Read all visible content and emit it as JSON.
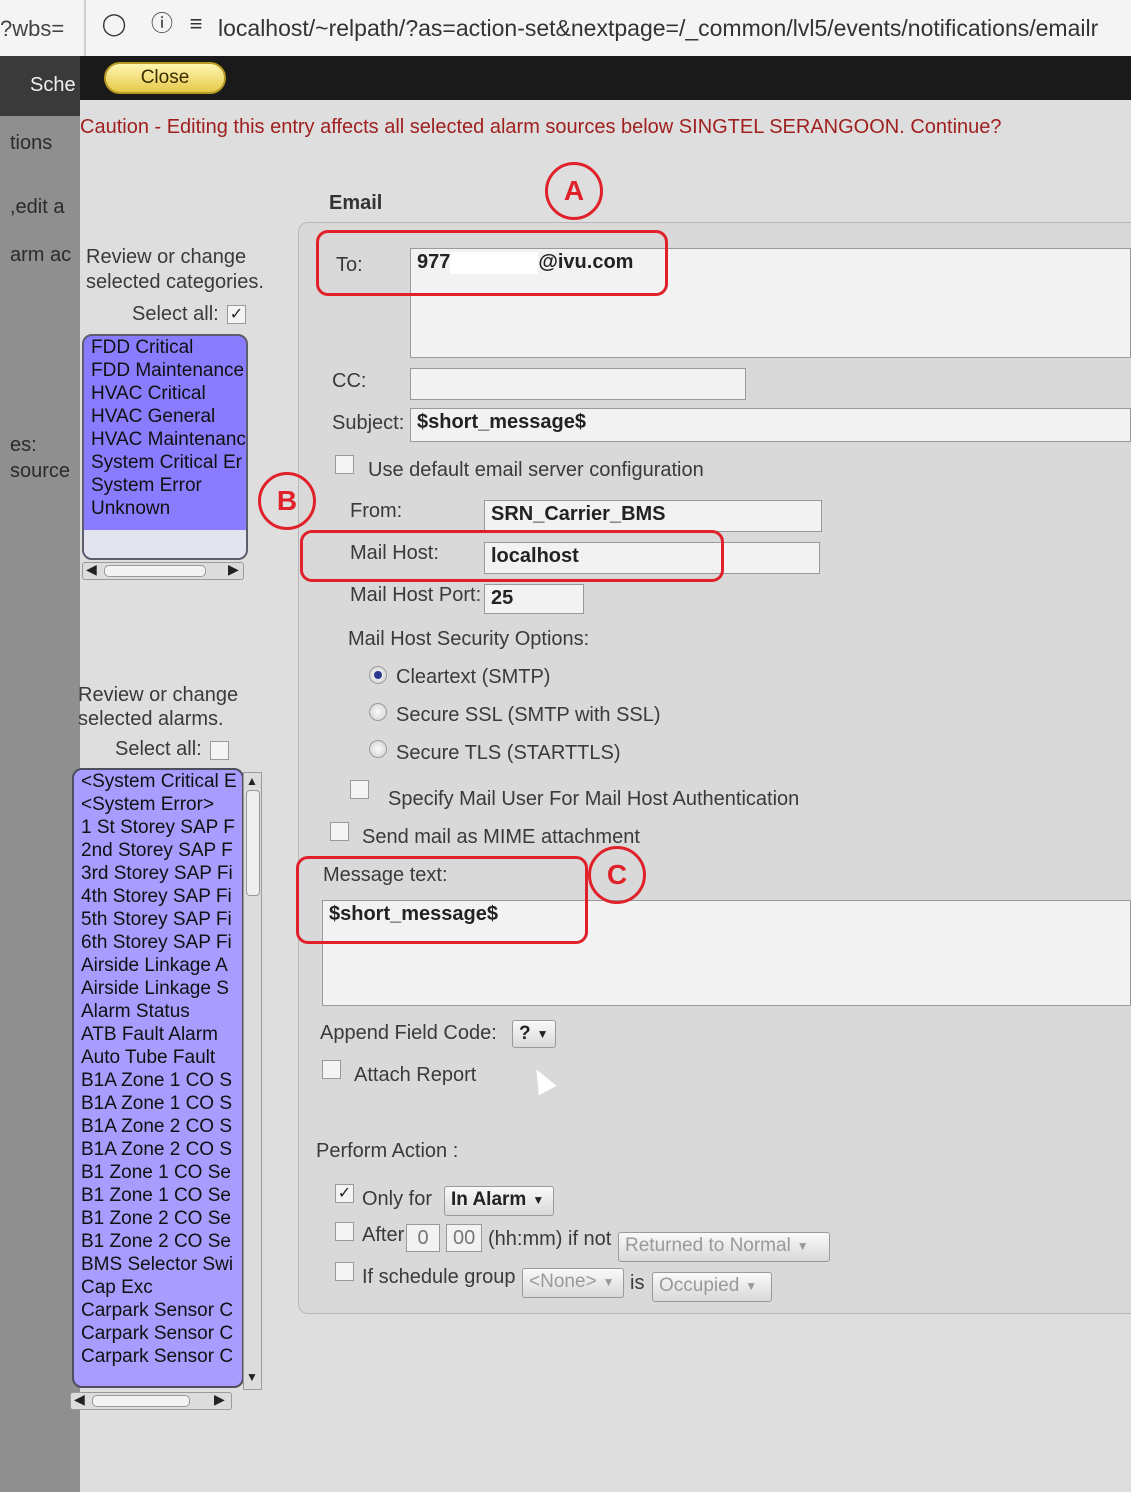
{
  "browser": {
    "left_fragment": "?wbs=",
    "url": "localhost/~relpath/?as=action-set&nextpage=/_common/lvl5/events/notifications/emailr"
  },
  "sidebar": {
    "sched": "Sche",
    "options": "tions",
    "edit": ",edit a",
    "alarm": "arm ac",
    "es": "es:",
    "source": "source"
  },
  "close_label": "Close",
  "caution": "Caution - Editing this entry affects all selected alarm sources below SINGTEL SERANGOON. Continue?",
  "categories": {
    "title_line1": "Review or change",
    "title_line2": "selected categories.",
    "select_all_label": "Select all:",
    "select_all_checked": true,
    "items": [
      "FDD Critical",
      "FDD Maintenance",
      "HVAC Critical",
      "HVAC General",
      "HVAC Maintenance",
      "System Critical Er",
      "System Error",
      "Unknown"
    ]
  },
  "alarms": {
    "title_line1": "Review or change",
    "title_line2": "selected alarms.",
    "select_all_label": "Select all:",
    "select_all_checked": false,
    "items": [
      "<System Critical E",
      "<System Error>",
      "1 St Storey SAP F",
      "2nd Storey SAP F",
      "3rd Storey SAP Fi",
      "4th Storey SAP Fi",
      "5th Storey SAP Fi",
      "6th Storey SAP Fi",
      "Airside Linkage A",
      "Airside Linkage S",
      "Alarm Status",
      "ATB Fault Alarm",
      "Auto Tube Fault",
      "B1A Zone 1 CO S",
      "B1A Zone 1 CO S",
      "B1A Zone 2 CO S",
      "B1A Zone 2 CO S",
      "B1 Zone 1 CO Se",
      "B1 Zone 1 CO Se",
      "B1 Zone 2 CO Se",
      "B1 Zone 2 CO Se",
      "BMS Selector Swi",
      "Cap Exc",
      "Carpark Sensor C",
      "Carpark Sensor C",
      "Carpark Sensor C"
    ]
  },
  "email": {
    "section_title": "Email",
    "to_label": "To:",
    "to_value": "977",
    "to_domain": "@ivu.com",
    "cc_label": "CC:",
    "cc_value": "",
    "subject_label": "Subject:",
    "subject_value": "$short_message$",
    "use_default_label": "Use default email server configuration",
    "use_default_checked": false,
    "from_label": "From:",
    "from_value": "SRN_Carrier_BMS",
    "mail_host_label": "Mail Host:",
    "mail_host_value": "localhost",
    "port_label": "Mail Host Port:",
    "port_value": "25",
    "security_label": "Mail Host Security Options:",
    "security_options": [
      {
        "label": "Cleartext (SMTP)",
        "selected": true
      },
      {
        "label": "Secure SSL (SMTP with SSL)",
        "selected": false
      },
      {
        "label": "Secure TLS (STARTTLS)",
        "selected": false
      }
    ],
    "specify_user_label": "Specify Mail User For Mail Host Authentication",
    "mime_label": "Send mail as MIME attachment",
    "message_label": "Message text:",
    "message_value": "$short_message$",
    "append_label": "Append Field Code:",
    "append_value": "?",
    "attach_label": "Attach Report",
    "perform_label": "Perform Action :",
    "only_for_label": "Only for",
    "only_for_checked": true,
    "only_for_value": "In Alarm",
    "after_label": "After",
    "after_hh": "0",
    "after_mm": "00",
    "after_suffix": "(hh:mm) if not",
    "after_select": "Returned to Normal",
    "schedule_label": "If schedule group",
    "schedule_value": "<None>",
    "is_label": "is",
    "occupied_value": "Occupied"
  },
  "annotations": {
    "a": "A",
    "b": "B",
    "c": "C"
  },
  "colors": {
    "annotation": "#e0212a",
    "list_selected": "#8a7cff",
    "caution": "#a02020"
  }
}
